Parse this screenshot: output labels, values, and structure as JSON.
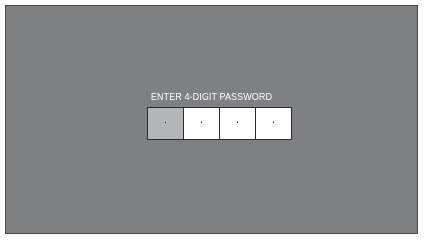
{
  "prompt": {
    "label": "ENTER 4-DIGIT PASSWORD"
  },
  "pin": {
    "digits": [
      {
        "value": "·",
        "active": true
      },
      {
        "value": "·",
        "active": false
      },
      {
        "value": "·",
        "active": false
      },
      {
        "value": "·",
        "active": false
      }
    ]
  },
  "colors": {
    "background": "#7f8084",
    "active_cell": "#b4b6b9",
    "cell": "#ffffff",
    "text": "#ffffff"
  }
}
